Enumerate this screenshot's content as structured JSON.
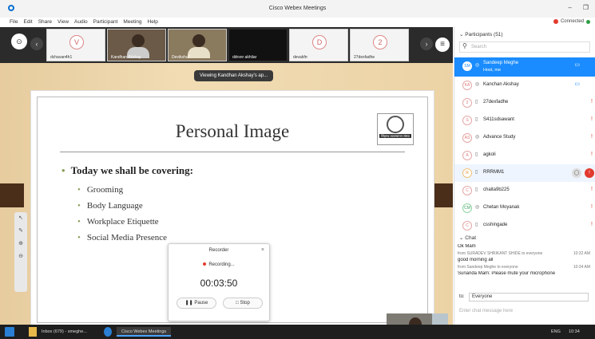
{
  "window": {
    "title": "Cisco Webex Meetings",
    "minimize": "–",
    "restore": "❐"
  },
  "menu": [
    "File",
    "Edit",
    "Share",
    "View",
    "Audio",
    "Participant",
    "Meeting",
    "Help"
  ],
  "connection": {
    "label": "Connected"
  },
  "thumbnails": [
    {
      "initial": "V",
      "name": "dchavan4h1",
      "kind": "avatar"
    },
    {
      "initial": "",
      "name": "Kandhan Akshay",
      "kind": "video"
    },
    {
      "initial": "",
      "name": "Devikshu7",
      "kind": "video"
    },
    {
      "initial": "",
      "name": "ddrsnr akhilar",
      "kind": "dark"
    },
    {
      "initial": "D",
      "name": "devakfrr",
      "kind": "avatar"
    },
    {
      "initial": "2",
      "name": "27dexfadhe",
      "kind": "avatar"
    }
  ],
  "viewing_banner": "Viewing Kandhan Akshay's ap...",
  "slide": {
    "title": "Personal Image",
    "logo_text": "सिंहगड व्यवस्थापन संस्था",
    "main_bullet": "Today we shall be covering:",
    "sub_bullets": [
      "Grooming",
      "Body Language",
      "Workplace Etiquette",
      "Social Media Presence"
    ]
  },
  "recorder": {
    "title": "Recorder",
    "status": "Recording...",
    "time": "00:03:50",
    "pause_label": "Pause",
    "stop_label": "Stop"
  },
  "participants": {
    "header": "Participants (51)",
    "search_placeholder": "Search",
    "rows": [
      {
        "initials": "SM",
        "name": "Sandeep Meghe",
        "role": "Host, me",
        "selected": true
      },
      {
        "initials": "KA",
        "name": "Kanchan Akshay",
        "role": "",
        "selected": false
      },
      {
        "initials": "2",
        "name": "27dexfadhe",
        "role": "",
        "selected": false
      },
      {
        "initials": "S",
        "name": "S411sdsawant",
        "role": "",
        "selected": false
      },
      {
        "initials": "AS",
        "name": "Advance Study",
        "role": "",
        "selected": false
      },
      {
        "initials": "A",
        "name": "agkoli",
        "role": "",
        "selected": false
      },
      {
        "initials": "R",
        "name": "RRRMM1",
        "role": "",
        "selected": false
      },
      {
        "initials": "C",
        "name": "chaita9b225",
        "role": "",
        "selected": false
      },
      {
        "initials": "CM",
        "name": "Chetan Moyanak",
        "role": "",
        "selected": false
      },
      {
        "initials": "C",
        "name": "csshingade",
        "role": "",
        "selected": false
      }
    ]
  },
  "chat": {
    "header": "Chat",
    "messages": [
      {
        "text": "Ok Mam",
        "meta": ""
      },
      {
        "text": "",
        "meta": "from SURADEV SHRIKANT SHIDE to everyone",
        "time": "10:32 AM"
      },
      {
        "text": "good morning all",
        "meta": ""
      },
      {
        "text": "",
        "meta": "from Sandeep Meghe to everyone",
        "time": "10:34 AM"
      },
      {
        "text": "Sunanda Mam: Please mute your microphone",
        "meta": ""
      }
    ],
    "to_label": "to:",
    "to_value": "Everyone",
    "input_placeholder": "Enter chat message here"
  },
  "taskbar": {
    "inbox": "Inbox (679) - smeghe...",
    "webex": "Cisco Webex Meetings",
    "lang": "ENG",
    "time": "10:34"
  },
  "colors": {
    "accent": "#1a8cff",
    "danger": "#e23a2e",
    "stage": "#ecd3a6"
  }
}
